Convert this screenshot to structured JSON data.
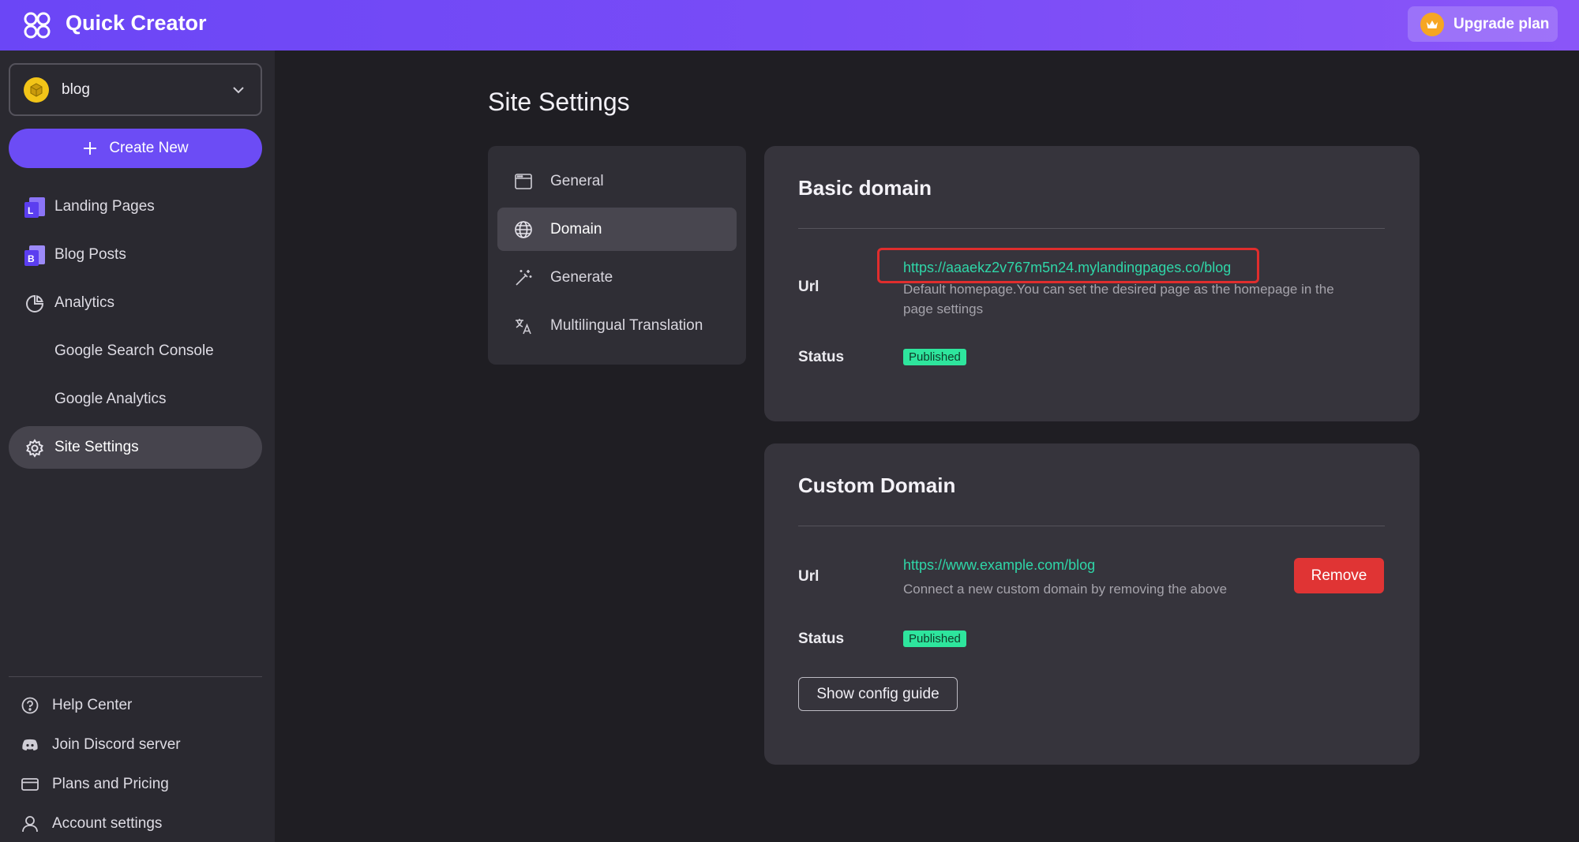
{
  "app": {
    "title": "Quick Creator",
    "upgrade_label": "Upgrade plan"
  },
  "site_selector": {
    "value": "blog"
  },
  "create_label": "Create New",
  "nav": {
    "landing_pages": "Landing Pages",
    "blog_posts": "Blog Posts",
    "analytics": "Analytics",
    "google_search_console": "Google Search Console",
    "google_analytics": "Google Analytics",
    "site_settings": "Site Settings"
  },
  "footer_nav": {
    "help_center": "Help Center",
    "discord": "Join Discord server",
    "plans": "Plans and Pricing",
    "account": "Account settings"
  },
  "page_title": "Site Settings",
  "settings_menu": {
    "general": "General",
    "domain": "Domain",
    "generate": "Generate",
    "translation": "Multilingual Translation"
  },
  "basic_domain": {
    "title": "Basic domain",
    "url_label": "Url",
    "url": "https://aaaekz2v767m5n24.mylandingpages.co/blog",
    "hint_line1": "Default homepage.You can set the desired page as the homepage in the",
    "hint_line2": "page settings",
    "status_label": "Status",
    "status": "Published"
  },
  "custom_domain": {
    "title": "Custom Domain",
    "url_label": "Url",
    "url": "https://www.example.com/blog",
    "hint": "Connect a new custom domain by removing the above",
    "remove_label": "Remove",
    "status_label": "Status",
    "status": "Published",
    "config_label": "Show config guide"
  },
  "colors": {
    "accent": "#6c4cf5",
    "link": "#2fd6a8",
    "published_badge": "#2ee59d",
    "danger": "#e03434"
  }
}
